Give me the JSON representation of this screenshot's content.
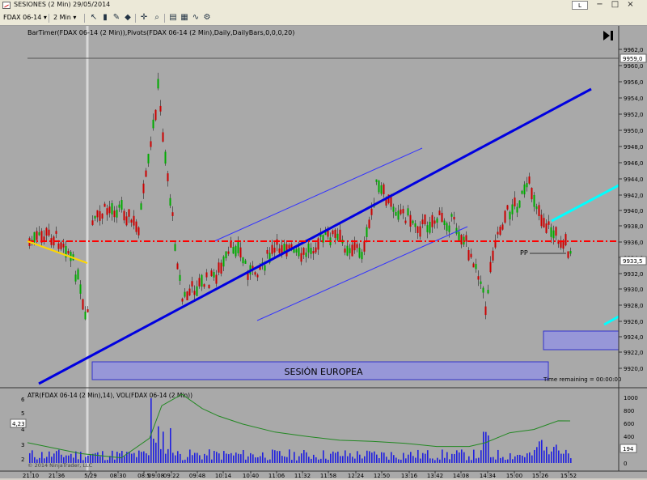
{
  "window": {
    "title": "SESIONES (2 Min)  29/05/2014",
    "l_button": "L",
    "min_glyph": "−",
    "max_glyph": "□",
    "close_glyph": "×"
  },
  "toolbar": {
    "instrument": "FDAX 06-14",
    "interval": "2 Min",
    "combo_arrow": "▾",
    "icons": [
      "pointer-icon",
      "pencil-icon",
      "crosshair-icon",
      "zoom-icon",
      "properties-icon",
      "data-box-icon",
      "indicators-icon",
      "strategy-icon"
    ]
  },
  "chart": {
    "indicators_label": "BarTimer(FDAX 06-14 (2 Min)),Pivots(FDAX 06-14 (2 Min),Daily,DailyBars,0,0,0,20)",
    "session_label": "SESIÓN EUROPEA",
    "pivot_label": "PP",
    "time_remaining": "Time remaining = 00:00:00",
    "y_labels": [
      "9962,0",
      "9960,0",
      "9956,0",
      "9954,0",
      "9952,0",
      "9950,0",
      "9948,0",
      "9946,0",
      "9944,0",
      "9942,0",
      "9940,0",
      "9938,0",
      "9936,0",
      "9934,0",
      "9932,0",
      "9930,0",
      "9928,0",
      "9926,0",
      "9924,0",
      "9922,0",
      "9920,0"
    ],
    "y_axis_top_value": "9959,0",
    "last_price": "9933,5",
    "colors": {
      "background": "#a9a9a9",
      "up_bar": "#00aa00",
      "down_bar": "#cc0000",
      "trend_line": "#0000e0",
      "pivot": "#ff0000",
      "channel": "#3333ff",
      "session_box": "#8888ff",
      "cyan": "#00ffff",
      "yellow": "#ffd700"
    }
  },
  "lower_panel": {
    "label": "ATR(FDAX 06-14 (2 Min),14), VOL(FDAX 06-14 (2 Min))",
    "atr_value": "4,23",
    "vol_value": "194",
    "left_ticks": [
      "6",
      "5",
      "4",
      "3",
      "2"
    ],
    "right_ticks": [
      "1000",
      "800",
      "600",
      "400",
      "200",
      "0"
    ],
    "copyright": "© 2014 NinjaTrader, LLC"
  },
  "x_axis": {
    "labels": [
      "21:10",
      "21:36",
      "5/29",
      "08:30",
      "08:5",
      "09:08",
      "09:22",
      "09:48",
      "10:14",
      "10:40",
      "11:06",
      "11:32",
      "11:58",
      "12:24",
      "12:50",
      "13:16",
      "13:42",
      "14:08",
      "14:34",
      "15:00",
      "15:26",
      "15:52"
    ]
  }
}
